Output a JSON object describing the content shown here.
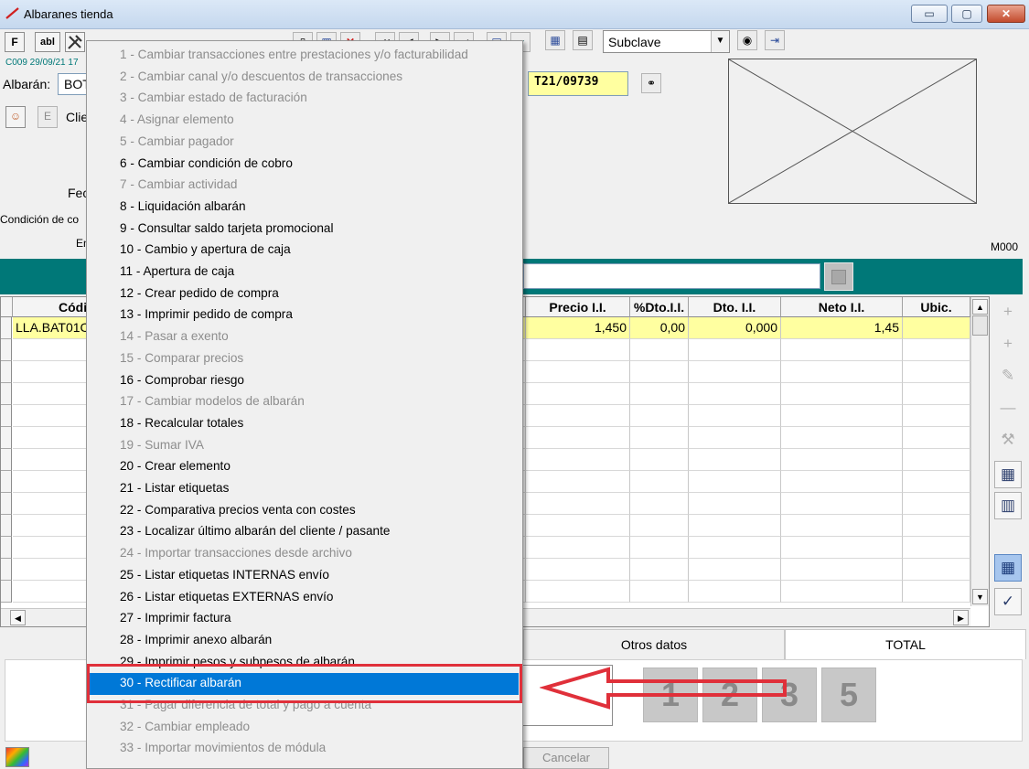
{
  "window": {
    "title": "Albaranes tienda",
    "controls": {
      "minimize": "▭",
      "maximize": "▢",
      "close": "✕"
    }
  },
  "toolbar": {
    "f_label": "F",
    "abl_label": "abl",
    "subclave_value": "Subclave"
  },
  "header": {
    "status_line": "C009 29/09/21 17",
    "albaran_label": "Albarán:",
    "albaran_value": "BOT",
    "doc_number": "T21/09739",
    "e_button": "E",
    "cliente_label": "Clie",
    "fecha_label": "Fec",
    "condicion_label": "Condición de co",
    "en_label": "En",
    "module_code": "M000"
  },
  "grid": {
    "columns": [
      {
        "key": "codigo",
        "label": "Códi"
      },
      {
        "key": "precio",
        "label": "Precio I.I."
      },
      {
        "key": "pdto",
        "label": "%Dto.I.I."
      },
      {
        "key": "dto",
        "label": "Dto. I.I."
      },
      {
        "key": "neto",
        "label": "Neto I.I."
      },
      {
        "key": "ubic",
        "label": "Ubic."
      }
    ],
    "rows": [
      {
        "codigo": "LLA.BAT01C",
        "precio": "1,450",
        "pdto": "0,00",
        "dto": "0,000",
        "neto": "1,45",
        "ubic": ""
      }
    ]
  },
  "tabs": [
    {
      "label": "Otros datos"
    },
    {
      "label": "TOTAL"
    }
  ],
  "number_buttons": [
    "1",
    "2",
    "3",
    "5"
  ],
  "footer": {
    "cancel_label": "Cancelar"
  },
  "context_menu": {
    "selected_index": 29,
    "items": [
      {
        "label": "1 - Cambiar transacciones entre prestaciones y/o facturabilidad",
        "enabled": false
      },
      {
        "label": "2 - Cambiar canal y/o descuentos de transacciones",
        "enabled": false
      },
      {
        "label": "3 - Cambiar estado de facturación",
        "enabled": false
      },
      {
        "label": "4 - Asignar elemento",
        "enabled": false
      },
      {
        "label": "5 - Cambiar pagador",
        "enabled": false
      },
      {
        "label": "6 - Cambiar condición de cobro",
        "enabled": true
      },
      {
        "label": "7 - Cambiar actividad",
        "enabled": false
      },
      {
        "label": "8 - Liquidación albarán",
        "enabled": true
      },
      {
        "label": "9 - Consultar saldo tarjeta promocional",
        "enabled": true
      },
      {
        "label": "10 - Cambio y apertura de caja",
        "enabled": true
      },
      {
        "label": "11 - Apertura de caja",
        "enabled": true
      },
      {
        "label": "12 - Crear pedido de compra",
        "enabled": true
      },
      {
        "label": "13 - Imprimir pedido de compra",
        "enabled": true
      },
      {
        "label": "14 - Pasar a exento",
        "enabled": false
      },
      {
        "label": "15 - Comparar precios",
        "enabled": false
      },
      {
        "label": "16 - Comprobar riesgo",
        "enabled": true
      },
      {
        "label": "17 - Cambiar modelos de albarán",
        "enabled": false
      },
      {
        "label": "18 - Recalcular totales",
        "enabled": true
      },
      {
        "label": "19 - Sumar IVA",
        "enabled": false
      },
      {
        "label": "20 - Crear elemento",
        "enabled": true
      },
      {
        "label": "21 - Listar etiquetas",
        "enabled": true
      },
      {
        "label": "22 - Comparativa precios venta con costes",
        "enabled": true
      },
      {
        "label": "23 - Localizar último albarán del cliente / pasante",
        "enabled": true
      },
      {
        "label": "24 - Importar transacciones desde archivo",
        "enabled": false
      },
      {
        "label": "25 - Listar etiquetas INTERNAS envío",
        "enabled": true
      },
      {
        "label": "26 - Listar etiquetas EXTERNAS envío",
        "enabled": true
      },
      {
        "label": "27 - Imprimir factura",
        "enabled": true
      },
      {
        "label": "28 - Imprimir anexo albarán",
        "enabled": true
      },
      {
        "label": "29 - Imprimir pesos y subpesos de albarán",
        "enabled": true
      },
      {
        "label": "30 - Rectificar albarán",
        "enabled": true
      },
      {
        "label": "31 - Pagar diferencia de total y pago a cuenta",
        "enabled": false
      },
      {
        "label": "32 - Cambiar empleado",
        "enabled": false
      },
      {
        "label": "33 - Importar movimientos de módula",
        "enabled": false
      }
    ]
  },
  "colors": {
    "accent_teal": "#007878",
    "selection_blue": "#0078d7",
    "annotation_red": "#e0303a",
    "row_highlight": "#ffffa0"
  }
}
